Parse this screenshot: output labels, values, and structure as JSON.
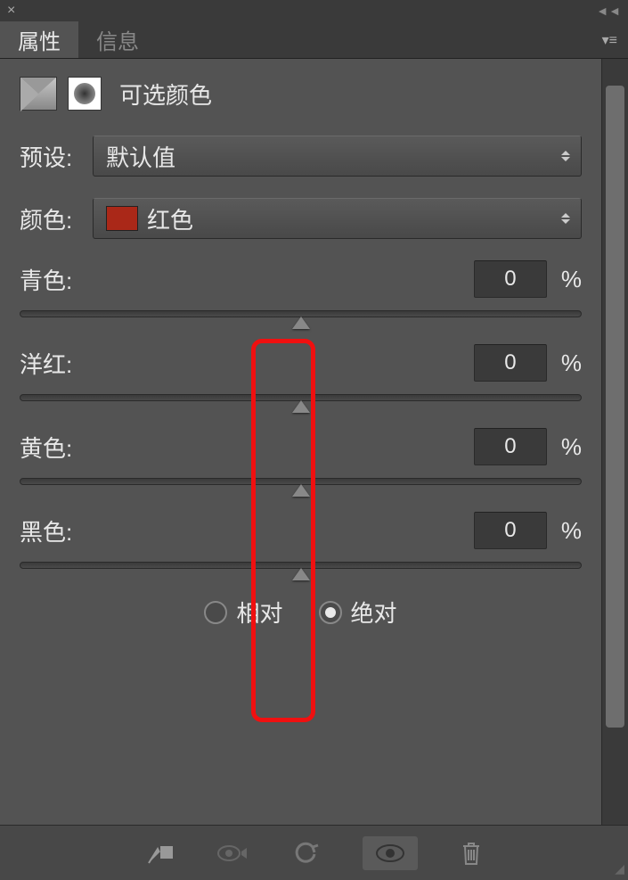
{
  "titlebar": {
    "close": "×",
    "collapse": "◄◄"
  },
  "tabs": {
    "active": "属性",
    "inactive": "信息",
    "menu": "▾≡"
  },
  "header": {
    "title": "可选颜色"
  },
  "preset": {
    "label": "预设:",
    "value": "默认值"
  },
  "color": {
    "label": "颜色:",
    "value": "红色",
    "swatch": "#aa2818"
  },
  "sliders": [
    {
      "label": "青色:",
      "value": "0",
      "unit": "%"
    },
    {
      "label": "洋红:",
      "value": "0",
      "unit": "%"
    },
    {
      "label": "黄色:",
      "value": "0",
      "unit": "%"
    },
    {
      "label": "黑色:",
      "value": "0",
      "unit": "%"
    }
  ],
  "method": {
    "relative": "相对",
    "absolute": "绝对",
    "selected": "absolute"
  },
  "bottom_icons": {
    "clip": "clip-mask",
    "view_previous": "view-previous",
    "reset": "reset",
    "visibility": "visibility",
    "trash": "trash"
  }
}
